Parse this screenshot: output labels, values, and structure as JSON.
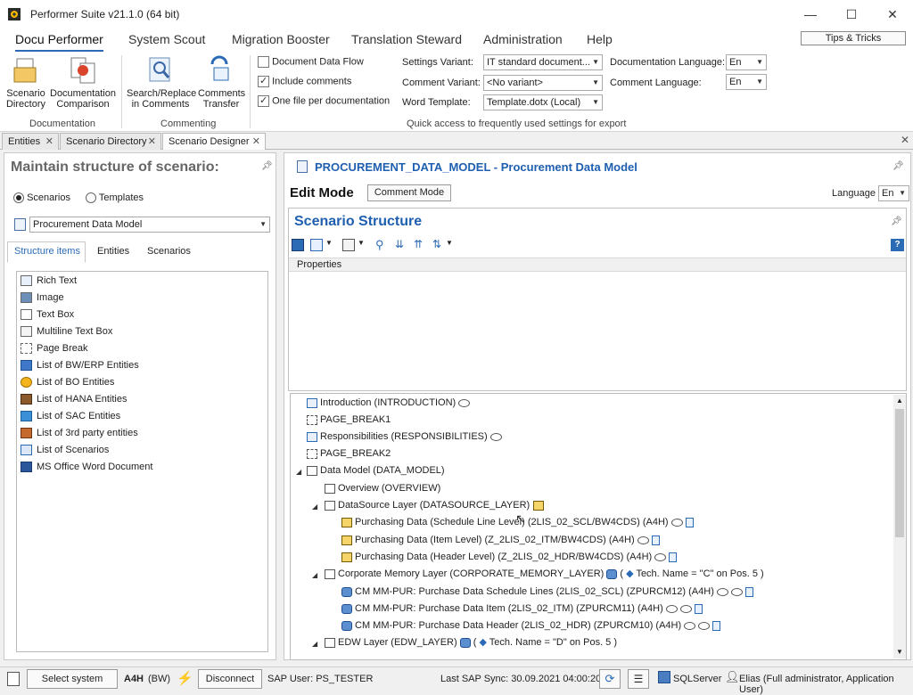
{
  "window": {
    "title": "Performer Suite v21.1.0 (64 bit)"
  },
  "menu": {
    "items": [
      "Docu Performer",
      "System Scout",
      "Migration Booster",
      "Translation Steward",
      "Administration",
      "Help"
    ],
    "tips_button": "Tips & Tricks"
  },
  "ribbon": {
    "buttons": {
      "scenario_directory": [
        "Scenario",
        "Directory"
      ],
      "documentation_comparison": [
        "Documentation",
        "Comparison"
      ],
      "search_replace": [
        "Search/Replace",
        "in Comments"
      ],
      "comments_transfer": [
        "Comments",
        "Transfer"
      ]
    },
    "groups": {
      "documentation": "Documentation",
      "commenting": "Commenting",
      "quick_access": "Quick access to frequently used settings for export"
    },
    "checkboxes": [
      {
        "label": "Document Data Flow",
        "checked": false
      },
      {
        "label": "Include comments",
        "checked": true
      },
      {
        "label": "One file per documentation",
        "checked": true
      }
    ],
    "fields": {
      "settings_variant_label": "Settings Variant:",
      "settings_variant_value": "IT standard document...",
      "comment_variant_label": "Comment Variant:",
      "comment_variant_value": "<No variant>",
      "word_template_label": "Word Template:",
      "word_template_value": "Template.dotx (Local)",
      "doc_language_label": "Documentation Language:",
      "doc_language_value": "En",
      "comment_language_label": "Comment Language:",
      "comment_language_value": "En"
    }
  },
  "tabs": {
    "entities": "Entities",
    "scenario_directory": "Scenario Directory",
    "scenario_designer": "Scenario Designer"
  },
  "left": {
    "title": "Maintain structure of scenario:",
    "radio_scenarios": "Scenarios",
    "radio_templates": "Templates",
    "selected_scenario": "Procurement Data Model",
    "subtabs": [
      "Structure items",
      "Entities",
      "Scenarios"
    ],
    "items": [
      "Rich Text",
      "Image",
      "Text Box",
      "Multiline Text Box",
      "Page Break",
      "List of BW/ERP Entities",
      "List of BO Entities",
      "List of HANA Entities",
      "List of SAC Entities",
      "List of 3rd party entities",
      "List of Scenarios",
      "MS Office Word Document"
    ]
  },
  "right": {
    "header_title": "PROCUREMENT_DATA_MODEL - Procurement Data Model",
    "edit_mode": "Edit Mode",
    "comment_mode_button": "Comment Mode",
    "language_label": "Language",
    "language_value": "En",
    "section_title": "Scenario Structure",
    "properties_label": "Properties",
    "tree": [
      "Introduction (INTRODUCTION)",
      "PAGE_BREAK1",
      "Responsibilities (RESPONSIBILITIES)",
      "PAGE_BREAK2",
      "Data Model (DATA_MODEL)",
      "Overview (OVERVIEW)",
      "DataSource Layer (DATASOURCE_LAYER)",
      "Purchasing Data (Schedule Line Level) (2LIS_02_SCL/BW4CDS) (A4H)",
      "Purchasing Data (Item Level) (Z_2LIS_02_ITM/BW4CDS) (A4H)",
      "Purchasing Data (Header Level) (Z_2LIS_02_HDR/BW4CDS) (A4H)",
      "Corporate Memory Layer (CORPORATE_MEMORY_LAYER)",
      "CM MM-PUR: Purchase Data Schedule Lines (2LIS_02_SCL) (ZPURCM12) (A4H)",
      "CM MM-PUR: Purchase Data Item (2LIS_02_ITM) (ZPURCM11) (A4H)",
      "CM MM-PUR: Purchase Data Header (2LIS_02_HDR) (ZPURCM10) (A4H)",
      "EDW Layer (EDW_LAYER)"
    ],
    "tech_name_c": "Tech. Name = \"C\" on Pos. 5 )",
    "tech_name_d": "Tech. Name = \"D\" on Pos. 5 )",
    "open_paren": "("
  },
  "status": {
    "select_system": "Select system",
    "system": "A4H",
    "system_type": "(BW)",
    "disconnect": "Disconnect",
    "sap_user": "SAP User: PS_TESTER",
    "last_sync": "Last SAP Sync: 30.09.2021 04:00:20",
    "db": "SQLServer",
    "user": "Elias (Full administrator, Application User)"
  }
}
